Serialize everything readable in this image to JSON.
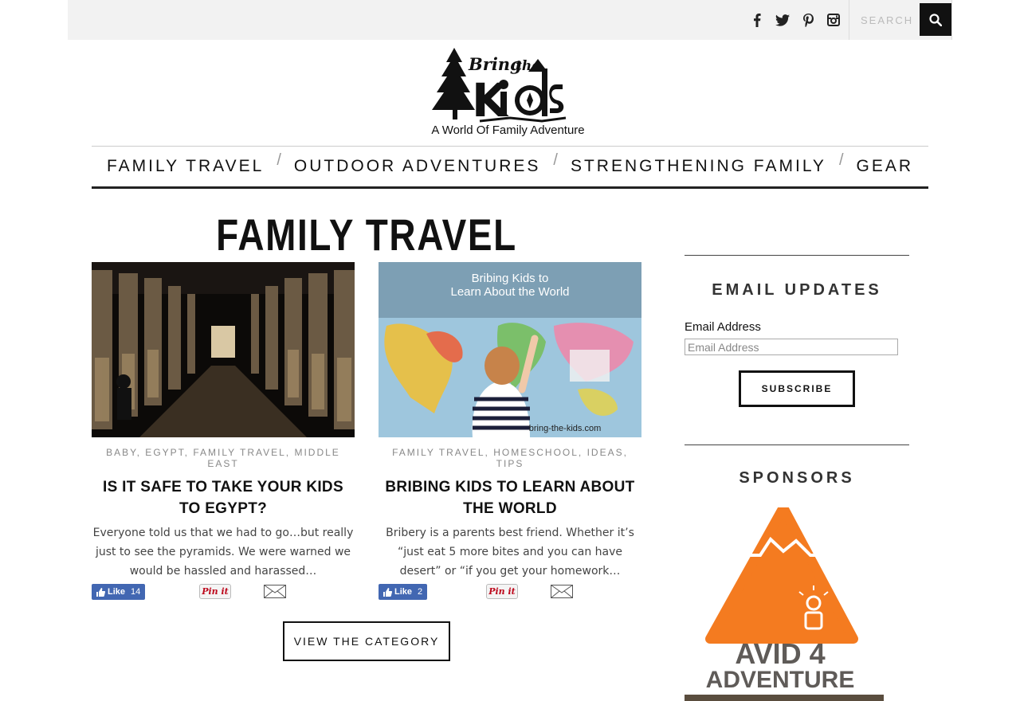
{
  "topbar": {
    "social_icons": [
      "facebook-icon",
      "twitter-icon",
      "pinterest-icon",
      "instagram-icon"
    ],
    "search_placeholder": "SEARCH"
  },
  "logo": {
    "title": "Bring the Kids",
    "tagline": "A World Of Family Adventure"
  },
  "nav": {
    "items": [
      "FAMILY TRAVEL",
      "OUTDOOR ADVENTURES",
      "STRENGTHENING FAMILY",
      "GEAR"
    ]
  },
  "page": {
    "title": "FAMILY TRAVEL"
  },
  "posts": [
    {
      "categories": "BABY, EGYPT, FAMILY TRAVEL, MIDDLE EAST",
      "title": "IS IT SAFE TO TAKE YOUR KIDS TO EGYPT?",
      "excerpt": "Everyone told us that we had to go…but really just to see the pyramids.   We were warned we would be hassled and harassed…",
      "like_label": "Like",
      "like_count": "14",
      "pin_label": "Pin it"
    },
    {
      "categories": "FAMILY TRAVEL, HOMESCHOOL, IDEAS, TIPS",
      "title": "BRIBING KIDS TO LEARN ABOUT THE WORLD",
      "excerpt": "Bribery is a parents best friend. Whether it’s “just eat 5 more bites and you can have desert” or  “if you get your homework…",
      "like_label": "Like",
      "like_count": "2",
      "pin_label": "Pin it",
      "image_caption_top": "Bribing Kids to",
      "image_caption_bottom": "Learn About the World",
      "image_watermark": "bring-the-kids.com"
    }
  ],
  "view_category_label": "VIEW THE CATEGORY",
  "sidebar": {
    "email_title": "EMAIL UPDATES",
    "email_label": "Email Address",
    "email_placeholder": "Email Address",
    "subscribe_label": "SUBSCRIBE",
    "sponsors_title": "SPONSORS",
    "sponsor_name_top": "AVID 4",
    "sponsor_name_bottom": "ADVENTURE"
  },
  "colors": {
    "topbar_bg": "#f2f2f2",
    "text": "#111111",
    "fb_blue": "#4267b2",
    "sponsor_orange": "#f47b20"
  }
}
